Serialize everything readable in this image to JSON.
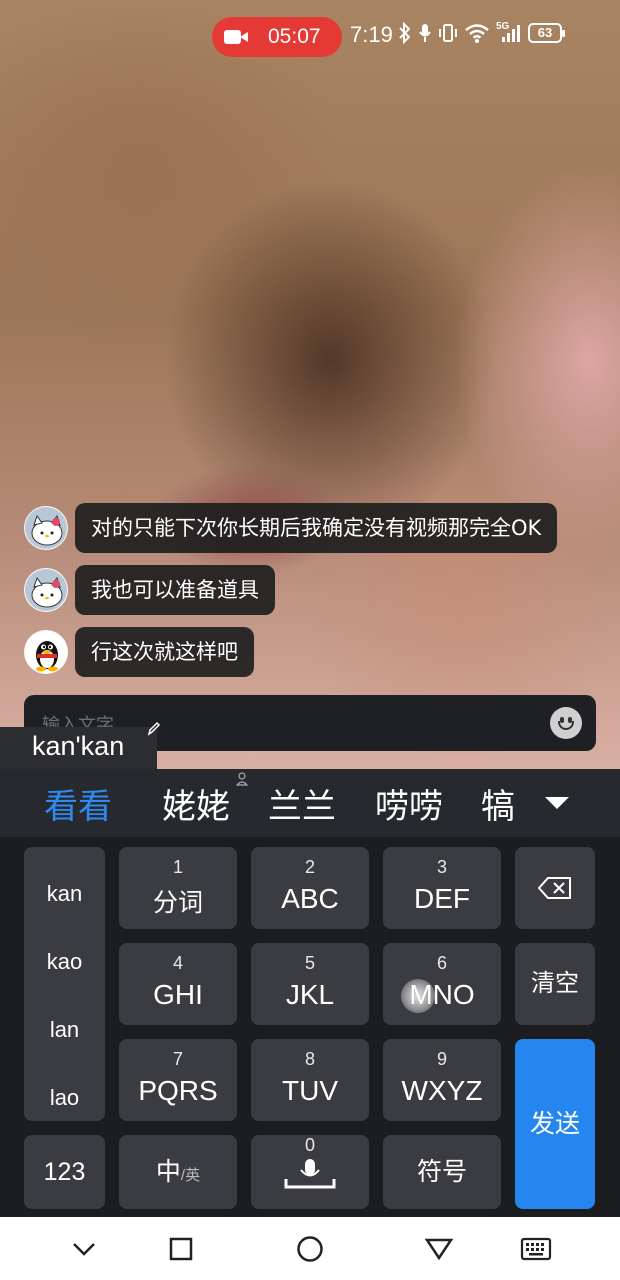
{
  "status_bar": {
    "recording_time": "05:07",
    "clock": "7:19",
    "network": "5G",
    "battery": "63",
    "icons": [
      "camera-icon",
      "bluetooth-icon",
      "mic-icon",
      "vibrate-icon",
      "wifi-icon",
      "signal-icon",
      "battery-icon"
    ],
    "rec_color": "#e53935"
  },
  "chat": {
    "messages": [
      {
        "avatar": "hello-kitty-avatar",
        "text": "对的只能下次你长期后我确定没有视频那完全OK"
      },
      {
        "avatar": "hello-kitty-avatar",
        "text": "我也可以准备道具"
      },
      {
        "avatar": "qq-penguin-avatar",
        "text": "行这次就这样吧"
      }
    ]
  },
  "input": {
    "placeholder": "输入文字"
  },
  "ime": {
    "composition": "kan'kan",
    "candidates": [
      "看看",
      "姥姥",
      "兰兰",
      "唠唠",
      "犒"
    ],
    "active_color": "#2f8bf3",
    "pinyin_options": [
      "kan",
      "kao",
      "lan",
      "lao"
    ],
    "keys": [
      {
        "num": "1",
        "letters": "分词"
      },
      {
        "num": "2",
        "letters": "ABC"
      },
      {
        "num": "3",
        "letters": "DEF"
      },
      {
        "num": "4",
        "letters": "GHI"
      },
      {
        "num": "5",
        "letters": "JKL"
      },
      {
        "num": "6",
        "letters": "MNO"
      },
      {
        "num": "7",
        "letters": "PQRS"
      },
      {
        "num": "8",
        "letters": "TUV"
      },
      {
        "num": "9",
        "letters": "WXYZ"
      }
    ],
    "clear_label": "清空",
    "send_label": "发送",
    "send_color": "#2586f0",
    "num_label": "123",
    "lang_label": "中",
    "lang_alt": "/英",
    "space_num": "0",
    "symbol_label": "符号"
  },
  "nav_bar": {
    "icons": [
      "collapse-keyboard-icon",
      "recents-icon",
      "home-icon",
      "back-icon",
      "keyboard-switch-icon"
    ]
  }
}
